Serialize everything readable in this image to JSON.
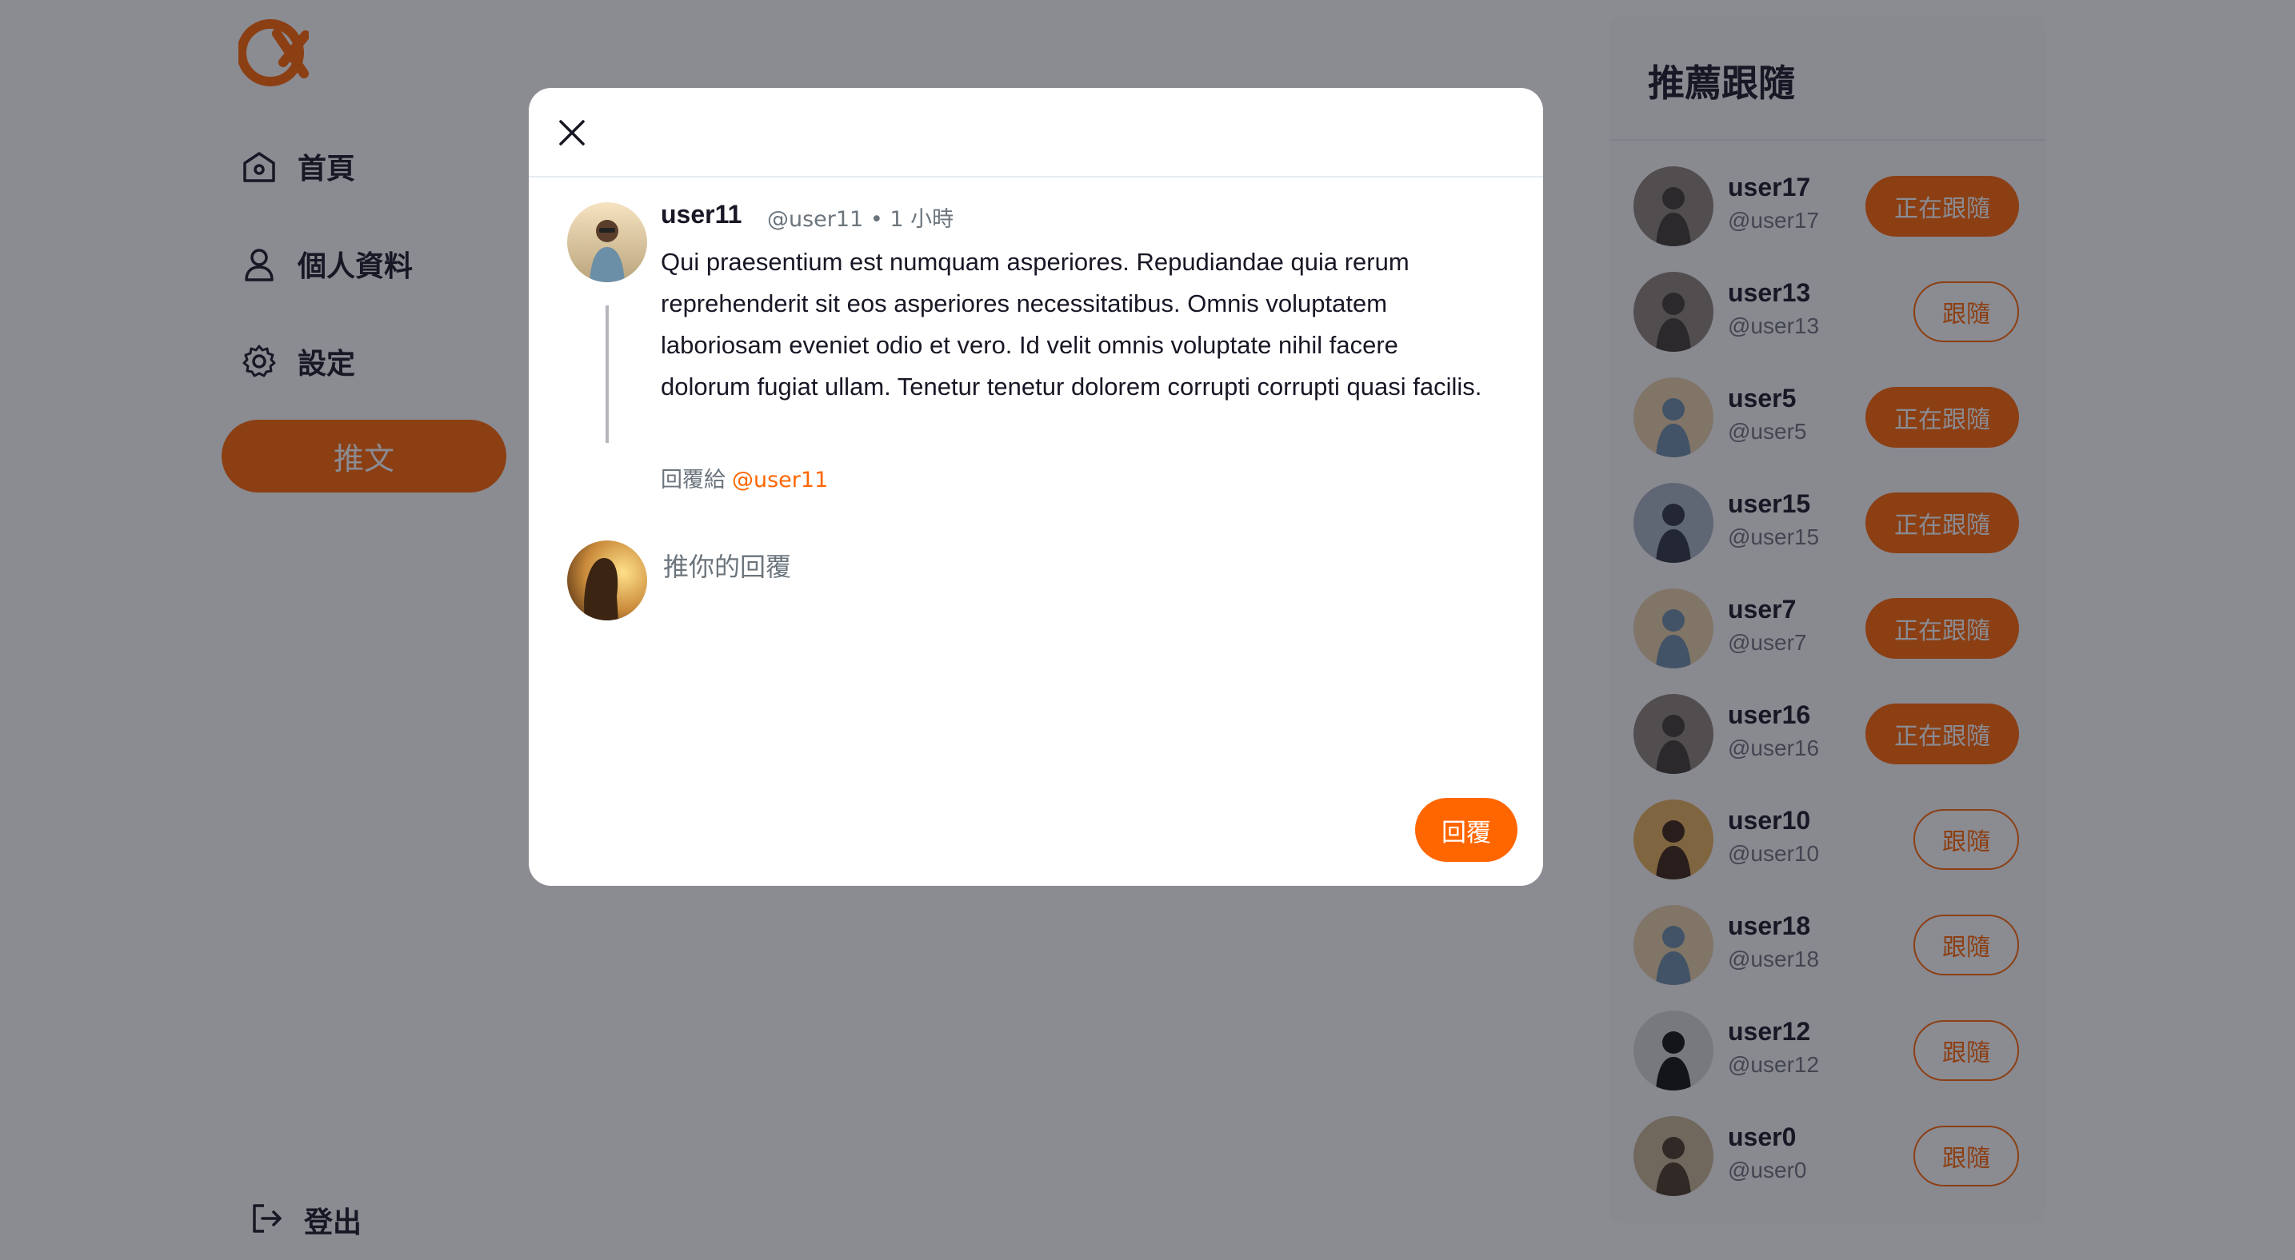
{
  "colors": {
    "brand": "#FF6600",
    "text_primary": "#171725",
    "text_secondary": "#6C757D",
    "overlay": "rgba(23,23,37,0.5)"
  },
  "sidebar": {
    "logo_icon": "alpha-logo-icon",
    "items": [
      {
        "label": "首頁",
        "icon": "home-icon"
      },
      {
        "label": "個人資料",
        "icon": "user-icon"
      },
      {
        "label": "設定",
        "icon": "gear-icon"
      }
    ],
    "tweet_button": "推文",
    "logout": {
      "label": "登出",
      "icon": "logout-icon"
    }
  },
  "recommend": {
    "title": "推薦跟隨",
    "users": [
      {
        "name": "user17",
        "handle": "@user17",
        "button": "正在跟隨",
        "state": "following"
      },
      {
        "name": "user13",
        "handle": "@user13",
        "button": "跟隨",
        "state": "follow"
      },
      {
        "name": "user5",
        "handle": "@user5",
        "button": "正在跟隨",
        "state": "following"
      },
      {
        "name": "user15",
        "handle": "@user15",
        "button": "正在跟隨",
        "state": "following"
      },
      {
        "name": "user7",
        "handle": "@user7",
        "button": "正在跟隨",
        "state": "following"
      },
      {
        "name": "user16",
        "handle": "@user16",
        "button": "正在跟隨",
        "state": "following"
      },
      {
        "name": "user10",
        "handle": "@user10",
        "button": "跟隨",
        "state": "follow"
      },
      {
        "name": "user18",
        "handle": "@user18",
        "button": "跟隨",
        "state": "follow"
      },
      {
        "name": "user12",
        "handle": "@user12",
        "button": "跟隨",
        "state": "follow"
      },
      {
        "name": "user0",
        "handle": "@user0",
        "button": "跟隨",
        "state": "follow"
      }
    ]
  },
  "modal": {
    "close_icon": "close-icon",
    "original": {
      "name": "user11",
      "meta": "@user11 • 1 小時",
      "body": "Qui praesentium est numquam asperiores. Repudiandae quia rerum reprehenderit sit eos asperiores necessitatibus. Omnis voluptatem laboriosam eveniet odio et vero. Id velit omnis voluptate nihil facere dolorum fugiat ullam. Tenetur tenetur dolorem corrupti corrupti quasi facilis.",
      "reply_to_label": "回覆給",
      "reply_to_mention": "@user11"
    },
    "reply": {
      "placeholder": "推你的回覆",
      "value": "",
      "button": "回覆"
    }
  }
}
